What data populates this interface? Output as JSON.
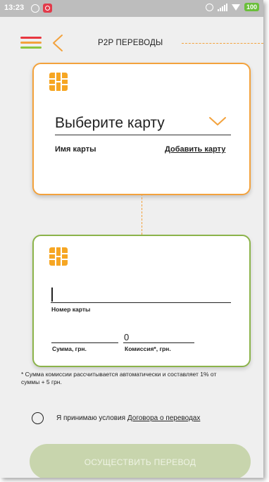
{
  "status_bar": {
    "time": "13:23",
    "battery": "100",
    "icons": [
      "whatsapp-icon",
      "app-notification-icon",
      "alarm-icon",
      "signal-icon",
      "wifi-icon",
      "battery-icon"
    ]
  },
  "header": {
    "title": "P2P ПЕРЕВОДЫ",
    "menu_icon": "hamburger-icon",
    "back_icon": "chevron-left-icon"
  },
  "source_card": {
    "chip_icon": "card-chip-icon",
    "select_label": "Выберите карту",
    "card_name_label": "Имя карты",
    "add_card_link": "Добавить карту"
  },
  "destination_card": {
    "chip_icon": "card-chip-icon",
    "card_number_value": "",
    "card_number_label": "Номер карты",
    "amount_value": "",
    "amount_label": "Сумма, грн.",
    "commission_value": "0",
    "commission_label": "Комиссия*, грн."
  },
  "commission_note": "* Сумма комиссии рассчитывается автоматически и составляет 1% от суммы + 5 грн.",
  "agreement": {
    "prefix": "Я принимаю условия ",
    "link_text": "Договора о переводах",
    "checked": false
  },
  "submit_button": "ОСУЩЕСТВИТЬ ПЕРЕВОД",
  "colors": {
    "accent_orange": "#f3a23c",
    "accent_green": "#8bb34a",
    "accent_red": "#e8363f",
    "button_disabled": "#c8d5ad"
  }
}
